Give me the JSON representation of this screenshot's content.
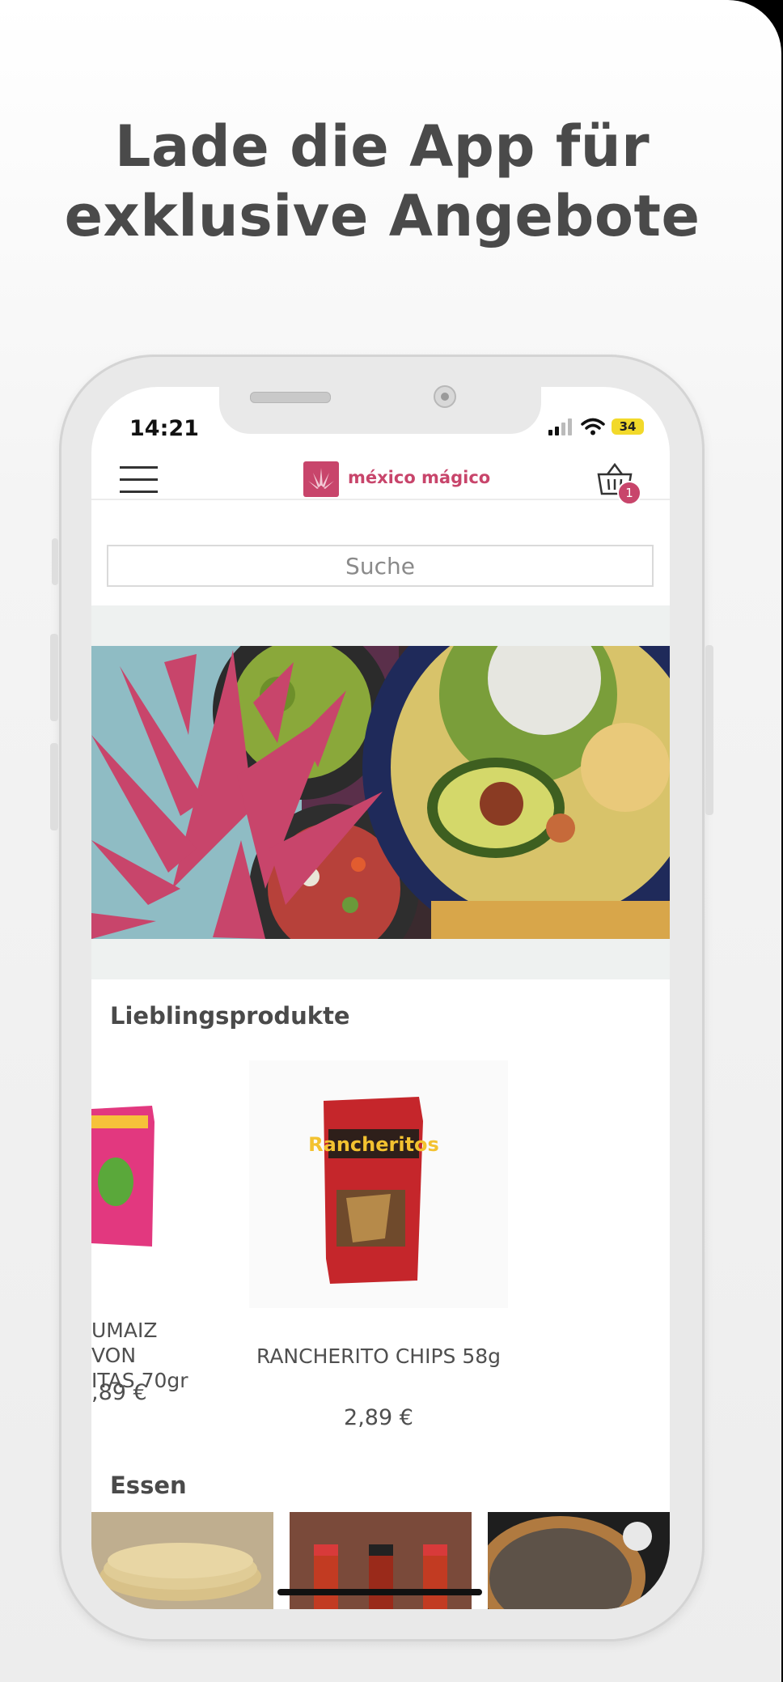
{
  "promo": {
    "headline_line1": "Lade die App für",
    "headline_line2": "exklusive Angebote"
  },
  "status_bar": {
    "time": "14:21",
    "battery": "34"
  },
  "header": {
    "brand": "méxico mágico",
    "cart_count": "1",
    "icons": [
      "hamburger-menu-icon",
      "agave-logo-icon",
      "basket-icon"
    ]
  },
  "search": {
    "placeholder": "Suche"
  },
  "favorites": {
    "title": "Lieblingsprodukte",
    "products": [
      {
        "name_line1": "UMAIZ VON",
        "name_line2": "ITAS 70gr",
        "price": ",89 €"
      },
      {
        "name": "RANCHERITO CHIPS 58g",
        "price": "2,89 €"
      }
    ]
  },
  "food_section": {
    "title": "Essen"
  },
  "colors": {
    "brand": "#c8456b",
    "text": "#4a4a4a",
    "band": "#eef1f0",
    "hero_teal": "#8fbcc4"
  }
}
